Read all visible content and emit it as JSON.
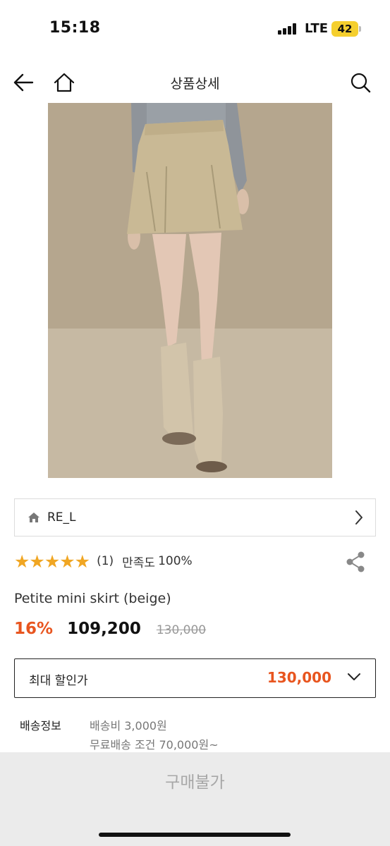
{
  "status": {
    "time": "15:18",
    "network": "LTE",
    "battery": "42"
  },
  "header": {
    "title": "상품상세"
  },
  "brand": {
    "name": "RE_L"
  },
  "rating": {
    "stars": "★★★★★",
    "count": "(1)",
    "satisfaction_label": "만족도",
    "satisfaction_value": "100%"
  },
  "product": {
    "name": "Petite mini skirt (beige)"
  },
  "price": {
    "discount": "16%",
    "sale": "109,200",
    "original": "130,000"
  },
  "max_discount": {
    "label": "최대 할인가",
    "value": "130,000"
  },
  "shipping": {
    "label": "배송정보",
    "fee": "배송비 3,000원",
    "free_condition": "무료배송 조건 70,000원~"
  },
  "buy": {
    "label": "구매불가"
  },
  "colors": {
    "accent": "#e8551f",
    "star": "#f0a623",
    "disabled_bg": "#ebebeb",
    "disabled_text": "#a7a7a7"
  }
}
